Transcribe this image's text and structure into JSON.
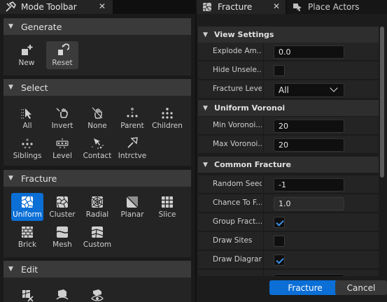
{
  "mode_toolbar": {
    "tab_title": "Mode Toolbar",
    "close_glyph": "✕",
    "sections": {
      "generate": {
        "title": "Generate",
        "tools": [
          {
            "label": "New",
            "icon": "new-geometry-icon",
            "selected": false
          },
          {
            "label": "Reset",
            "icon": "reset-icon",
            "selected": false
          }
        ]
      },
      "select": {
        "title": "Select",
        "tools": [
          {
            "label": "All",
            "icon": "select-all-icon"
          },
          {
            "label": "Invert",
            "icon": "invert-selection-icon"
          },
          {
            "label": "None",
            "icon": "select-none-icon"
          },
          {
            "label": "Parent",
            "icon": "select-parent-icon"
          },
          {
            "label": "Children",
            "icon": "select-children-icon"
          },
          {
            "label": "Siblings",
            "icon": "select-siblings-icon"
          },
          {
            "label": "Level",
            "icon": "select-level-icon"
          },
          {
            "label": "Contact",
            "icon": "select-contact-icon"
          },
          {
            "label": "Intrctve",
            "icon": "interactive-select-icon"
          }
        ]
      },
      "fracture": {
        "title": "Fracture",
        "tools": [
          {
            "label": "Uniform",
            "icon": "uniform-fracture-icon",
            "selected": true
          },
          {
            "label": "Cluster",
            "icon": "cluster-fracture-icon"
          },
          {
            "label": "Radial",
            "icon": "radial-fracture-icon"
          },
          {
            "label": "Planar",
            "icon": "planar-fracture-icon"
          },
          {
            "label": "Slice",
            "icon": "slice-fracture-icon"
          },
          {
            "label": "Brick",
            "icon": "brick-fracture-icon"
          },
          {
            "label": "Mesh",
            "icon": "mesh-fracture-icon"
          },
          {
            "label": "Custom",
            "icon": "custom-fracture-icon"
          }
        ]
      },
      "edit": {
        "title": "Edit",
        "tools": [
          {
            "icon": "prune-icon"
          },
          {
            "icon": "hide-icon"
          },
          {
            "icon": "unhide-icon"
          }
        ]
      }
    }
  },
  "fracture_panel": {
    "tabs": [
      {
        "label": "Fracture",
        "icon": "fracture-tab-icon",
        "active": true
      },
      {
        "label": "Place Actors",
        "icon": "place-actors-icon",
        "active": false
      }
    ],
    "close_glyph": "✕",
    "categories": {
      "view_settings": {
        "title": "View Settings",
        "rows": [
          {
            "label": "Explode Am...",
            "type": "number",
            "value": "0.0"
          },
          {
            "label": "Hide Unsele...",
            "type": "checkbox",
            "checked": false
          },
          {
            "label": "Fracture Level",
            "type": "combo",
            "value": "All"
          }
        ]
      },
      "uniform_voronoi": {
        "title": "Uniform Voronoi",
        "rows": [
          {
            "label": "Min Voronoi...",
            "type": "number",
            "value": "20"
          },
          {
            "label": "Max Voronoi...",
            "type": "number",
            "value": "20"
          }
        ]
      },
      "common_fracture": {
        "title": "Common Fracture",
        "rows": [
          {
            "label": "Random Seed",
            "type": "number",
            "value": "-1"
          },
          {
            "label": "Chance To F...",
            "type": "number",
            "value": "1.0",
            "dim": true
          },
          {
            "label": "Group Fract...",
            "type": "checkbox",
            "checked": true
          },
          {
            "label": "Draw Sites",
            "type": "checkbox",
            "checked": false
          },
          {
            "label": "Draw Diagram",
            "type": "checkbox",
            "checked": true
          }
        ]
      }
    },
    "buttons": {
      "primary": "Fracture",
      "secondary": "Cancel"
    },
    "colors": {
      "accent": "#0b6fd6",
      "checkmark": "#3b8ee6"
    }
  }
}
